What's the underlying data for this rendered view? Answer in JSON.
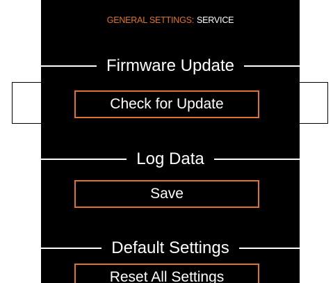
{
  "header": {
    "category": "GENERAL SETTINGS:",
    "section": "SERVICE"
  },
  "firmware": {
    "title": "Firmware Update",
    "button_label": "Check for Update"
  },
  "log": {
    "title": "Log Data",
    "button_label": "Save"
  },
  "defaults": {
    "title": "Default Settings",
    "button_label": "Reset All Settings"
  },
  "colors": {
    "accent": "#e0732a",
    "background": "#000000",
    "text": "#ffffff"
  }
}
